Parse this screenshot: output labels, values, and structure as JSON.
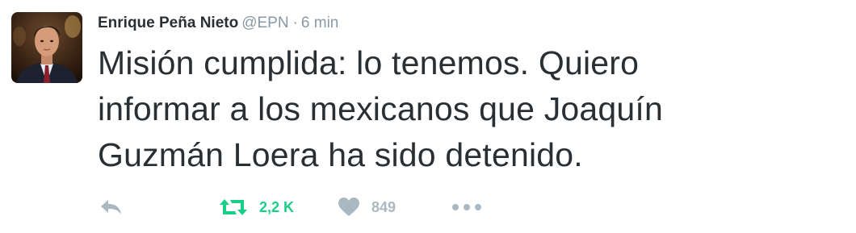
{
  "tweet": {
    "author": {
      "name": "Enrique Peña Nieto",
      "handle": "@EPN"
    },
    "separator": "·",
    "time": "6 min",
    "text_lines": [
      "Misión cumplida: lo tenemos. Quiero",
      "informar a los mexicanos que Joaquín",
      "Guzmán Loera ha sido detenido."
    ],
    "actions": {
      "reply": {
        "icon": "reply-icon"
      },
      "retweet": {
        "icon": "retweet-icon",
        "count": "2,2 K",
        "color": "#19cf86"
      },
      "like": {
        "icon": "heart-icon",
        "count": "849",
        "color": "#aab8c2"
      },
      "more": {
        "icon": "more-icon"
      }
    }
  },
  "colors": {
    "text": "#292f33",
    "muted": "#8899a6",
    "icon_gray": "#aab8c2",
    "retweet_green": "#19cf86"
  }
}
